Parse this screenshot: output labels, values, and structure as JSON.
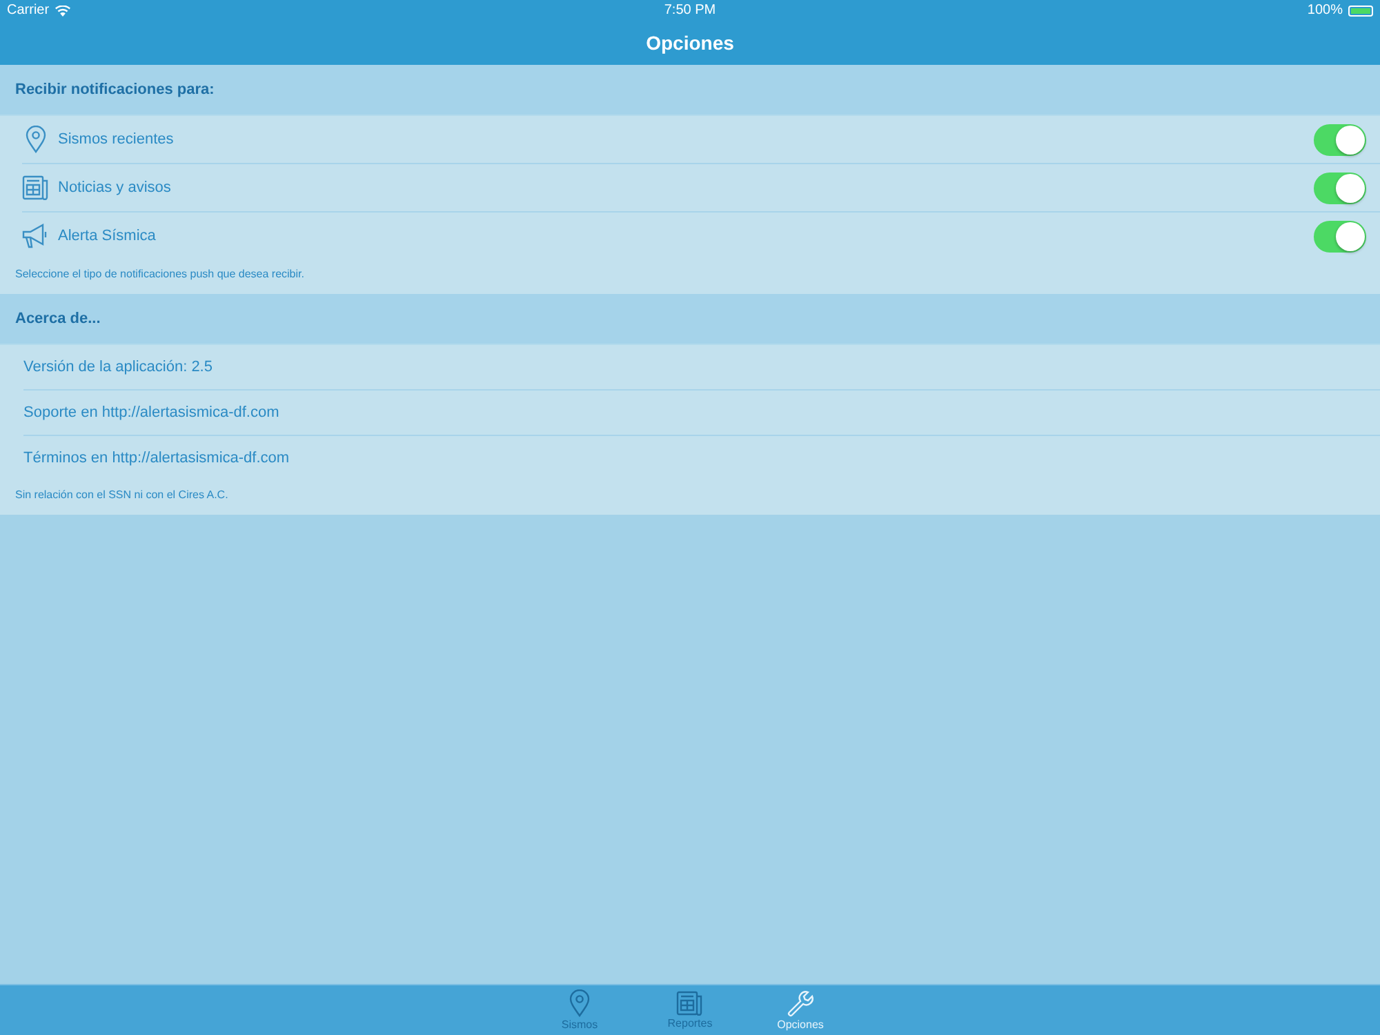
{
  "status_bar": {
    "carrier": "Carrier",
    "time": "7:50 PM",
    "battery": "100%"
  },
  "nav_bar": {
    "title": "Opciones"
  },
  "notifications": {
    "header": "Recibir notificaciones para:",
    "items": [
      {
        "label": "Sismos recientes",
        "on": true
      },
      {
        "label": "Noticias y avisos",
        "on": true
      },
      {
        "label": "Alerta Sísmica",
        "on": true
      }
    ],
    "footer": "Seleccione el tipo de notificaciones push que desea recibir."
  },
  "about": {
    "header": "Acerca de...",
    "items": [
      "Versión de la aplicación: 2.5",
      "Soporte en http://alertasismica-df.com",
      "Términos en http://alertasismica-df.com"
    ],
    "footer": "Sin relación con el SSN ni con el Cires A.C."
  },
  "tab_bar": [
    {
      "label": "Sismos",
      "selected": false
    },
    {
      "label": "Reportes",
      "selected": false
    },
    {
      "label": "Opciones",
      "selected": true
    }
  ]
}
